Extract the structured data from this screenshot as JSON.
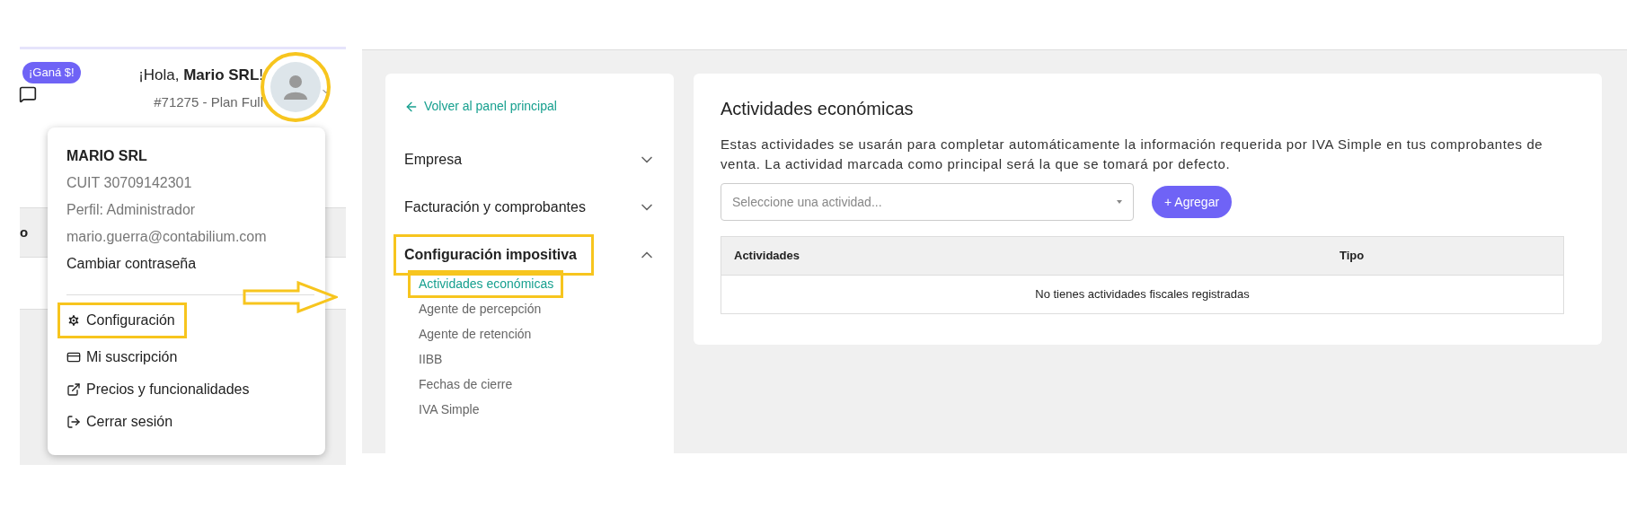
{
  "user_header": {
    "badge": "¡Ganá $!",
    "greeting": "¡Hola, **Mario SRL**!",
    "account": "#71275 - Plan Full",
    "avatar_highlighted": true
  },
  "background_table": {
    "cell": "o"
  },
  "user_menu": {
    "company": "MARIO SRL",
    "details": [
      "CUIT 30709142301",
      "Perfil: Administrador",
      "mario.guerra@contabilium.com"
    ],
    "link": "Cambiar contraseña",
    "items": [
      {
        "kind": "gear",
        "label": "Configuración",
        "highlighted": true
      },
      {
        "kind": "card",
        "label": "Mi suscripción",
        "highlighted": false
      },
      {
        "kind": "external",
        "label": "Precios y funcionalidades",
        "highlighted": false
      },
      {
        "kind": "logout",
        "label": "Cerrar sesión",
        "highlighted": false
      }
    ]
  },
  "settings_nav": {
    "back_link": "Volver al panel principal",
    "sections": [
      {
        "label": "Empresa",
        "expanded": false,
        "highlighted": false
      },
      {
        "label": "Facturación y comprobantes",
        "expanded": false,
        "highlighted": false
      },
      {
        "label": "Configuración impositiva",
        "expanded": true,
        "highlighted": true,
        "children": [
          {
            "label": "Actividades económicas",
            "selected": true,
            "highlighted": true
          },
          {
            "label": "Agente de percepción",
            "selected": false,
            "highlighted": false
          },
          {
            "label": "Agente de retención",
            "selected": false,
            "highlighted": false
          },
          {
            "label": "IIBB",
            "selected": false,
            "highlighted": false
          },
          {
            "label": "Fechas de cierre",
            "selected": false,
            "highlighted": false
          },
          {
            "label": "IVA Simple",
            "selected": false,
            "highlighted": false
          }
        ]
      }
    ]
  },
  "content": {
    "title": "Actividades económicas",
    "description": "Estas actividades se usarán para completar automáticamente la información requerida por IVA Simple en tus comprobantes de venta. La actividad marcada como principal será la que se tomará por defecto.",
    "select": {
      "placeholder": "Seleccione una actividad..."
    },
    "add_button": "+ Agregar",
    "table": {
      "columns": [
        "Actividades",
        "Tipo"
      ],
      "empty_message": "No tienes actividades fiscales registradas"
    }
  }
}
